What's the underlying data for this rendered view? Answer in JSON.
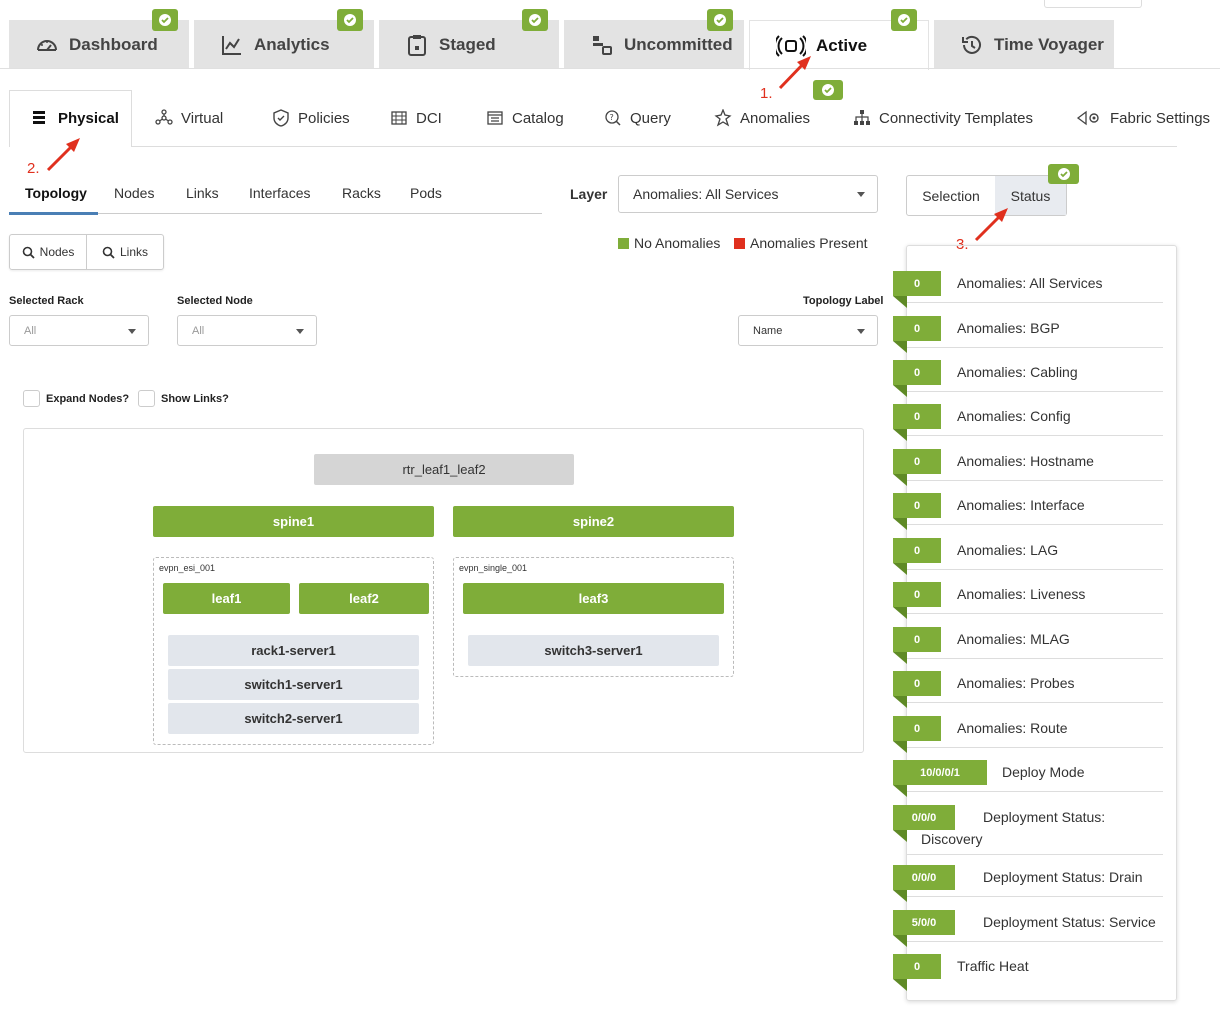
{
  "top_tabs": [
    {
      "label": "Dashboard",
      "icon": "dashboard-icon"
    },
    {
      "label": "Analytics",
      "icon": "chart-line-icon"
    },
    {
      "label": "Staged",
      "icon": "clipboard-icon"
    },
    {
      "label": "Uncommitted",
      "icon": "uncommitted-icon"
    },
    {
      "label": "Active",
      "icon": "broadcast-icon"
    },
    {
      "label": "Time Voyager",
      "icon": "history-icon"
    }
  ],
  "nav": {
    "physical": "Physical",
    "virtual": "Virtual",
    "policies": "Policies",
    "dci": "DCI",
    "catalog": "Catalog",
    "query": "Query",
    "anomalies": "Anomalies",
    "connectivity_templates": "Connectivity Templates",
    "fabric_settings": "Fabric Settings"
  },
  "sub_tabs": {
    "topology": "Topology",
    "nodes": "Nodes",
    "links": "Links",
    "interfaces": "Interfaces",
    "racks": "Racks",
    "pods": "Pods"
  },
  "layer": {
    "label": "Layer",
    "value": "Anomalies: All Services"
  },
  "legend": {
    "no_anomalies": "No Anomalies",
    "anomalies_present": "Anomalies Present",
    "green": "#7fad39",
    "red": "#e0301e"
  },
  "buttons": {
    "nodes": "Nodes",
    "links": "Links"
  },
  "filters": {
    "selected_rack_label": "Selected Rack",
    "selected_rack_value": "All",
    "selected_node_label": "Selected Node",
    "selected_node_value": "All",
    "topology_label_label": "Topology Label",
    "topology_label_value": "Name"
  },
  "checkboxes": {
    "expand_nodes": "Expand Nodes?",
    "show_links": "Show Links?"
  },
  "topology": {
    "router": "rtr_leaf1_leaf2",
    "spines": [
      "spine1",
      "spine2"
    ],
    "racks": [
      {
        "name": "evpn_esi_001",
        "leafs": [
          "leaf1",
          "leaf2"
        ],
        "servers": [
          "rack1-server1",
          "switch1-server1",
          "switch2-server1"
        ]
      },
      {
        "name": "evpn_single_001",
        "leafs": [
          "leaf3"
        ],
        "servers": [
          "switch3-server1"
        ]
      }
    ]
  },
  "right_panel": {
    "selection": "Selection",
    "status": "Status",
    "rows": [
      {
        "count": "0",
        "label": "Anomalies: All Services"
      },
      {
        "count": "0",
        "label": "Anomalies: BGP"
      },
      {
        "count": "0",
        "label": "Anomalies: Cabling"
      },
      {
        "count": "0",
        "label": "Anomalies: Config"
      },
      {
        "count": "0",
        "label": "Anomalies: Hostname"
      },
      {
        "count": "0",
        "label": "Anomalies: Interface"
      },
      {
        "count": "0",
        "label": "Anomalies: LAG"
      },
      {
        "count": "0",
        "label": "Anomalies: Liveness"
      },
      {
        "count": "0",
        "label": "Anomalies: MLAG"
      },
      {
        "count": "0",
        "label": "Anomalies: Probes"
      },
      {
        "count": "0",
        "label": "Anomalies: Route"
      },
      {
        "count": "10/0/0/1",
        "label": "Deploy Mode"
      },
      {
        "count": "0/0/0",
        "label_line1": "Deployment Status:",
        "label_line2": "Discovery"
      },
      {
        "count": "0/0/0",
        "label": "Deployment Status: Drain"
      },
      {
        "count": "5/0/0",
        "label": "Deployment Status: Service"
      },
      {
        "count": "0",
        "label": "Traffic Heat"
      }
    ]
  },
  "annotations": {
    "a1": "1.",
    "a2": "2.",
    "a3": "3."
  }
}
